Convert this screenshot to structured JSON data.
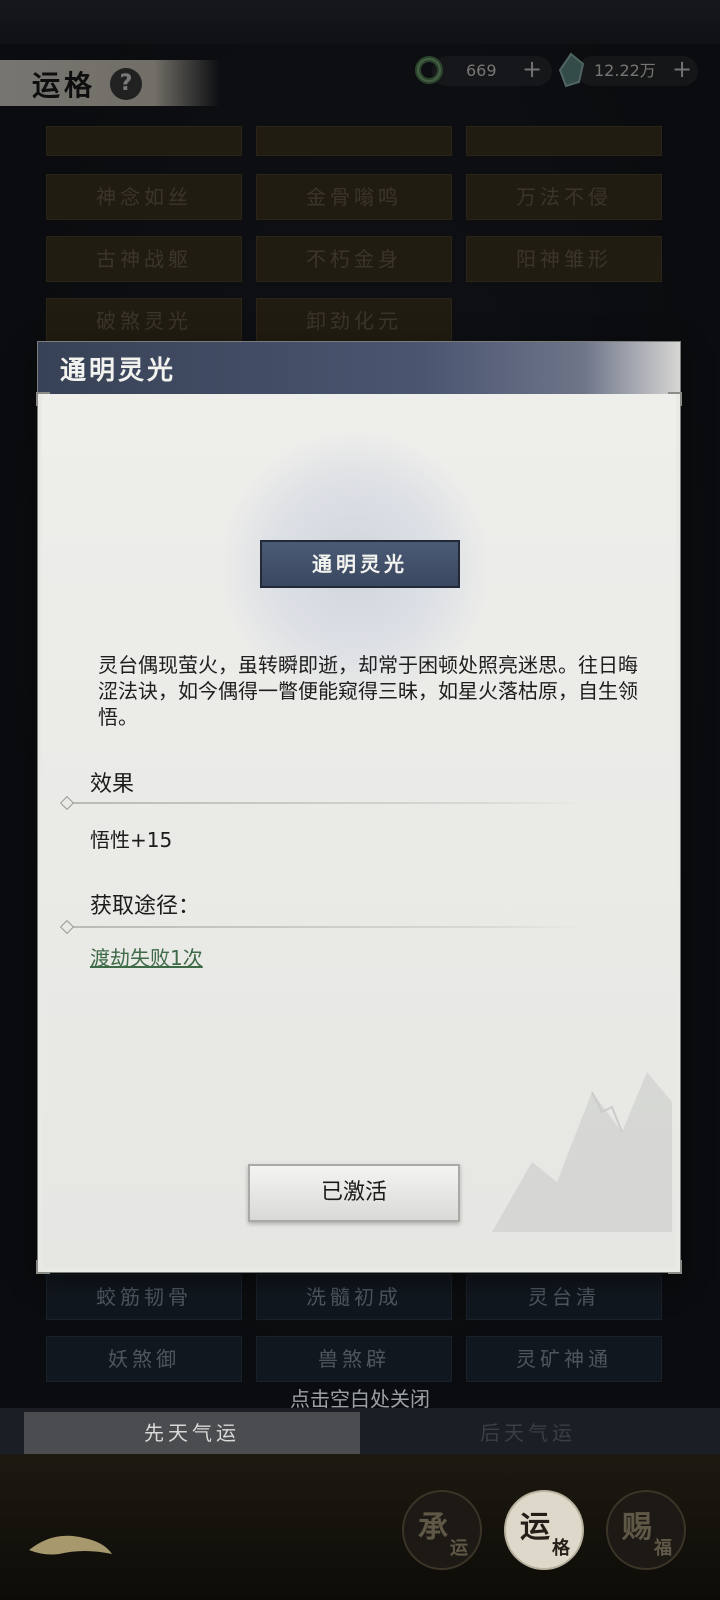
{
  "header": {
    "title": "运格",
    "help_icon": "question-icon",
    "resources": [
      {
        "icon": "jade-ring-icon",
        "value": "669",
        "plus": "+"
      },
      {
        "icon": "spirit-stone-icon",
        "value": "12.22万",
        "plus": "+"
      }
    ]
  },
  "grid": {
    "rows": [
      [
        "神念如丝",
        "金骨嗡鸣",
        "万法不侵"
      ],
      [
        "古神战躯",
        "不朽金身",
        "阳神雏形"
      ],
      [
        "破煞灵光",
        "卸劲化元"
      ]
    ],
    "bottom_rows": [
      [
        "蛟筋韧骨",
        "洗髓初成",
        "灵台清"
      ],
      [
        "妖煞御",
        "兽煞辟",
        "灵矿神通"
      ]
    ]
  },
  "modal": {
    "title": "通明灵光",
    "name_plate": "通明灵光",
    "description": "灵台偶现萤火，虽转瞬即逝，却常于困顿处照亮迷思。往日晦涩法诀，如今偶得一瞥便能窥得三昧，如星火落枯原，自生领悟。",
    "effect_label": "效果",
    "effect_value": "悟性+15",
    "source_label": "获取途径：",
    "source_value": "渡劫失败1次",
    "activate_button": "已激活"
  },
  "close_hint": "点击空白处关闭",
  "tabs": {
    "active": "先天气运",
    "inactive": "后天气运"
  },
  "bottom_nav": [
    {
      "big": "承",
      "small": "运"
    },
    {
      "big": "运",
      "small": "格"
    },
    {
      "big": "赐",
      "small": "福"
    }
  ]
}
